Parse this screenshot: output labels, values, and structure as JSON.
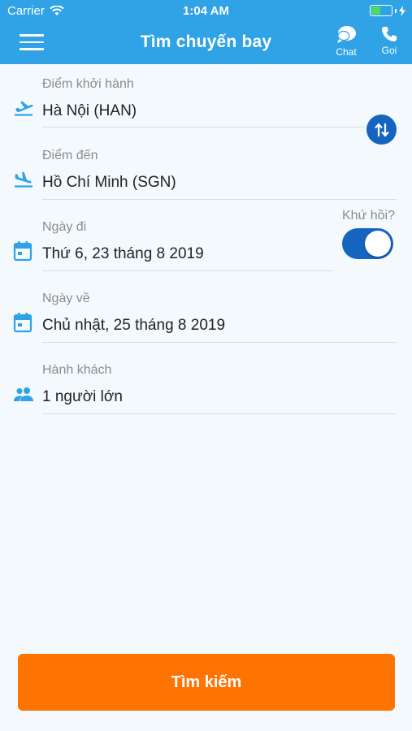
{
  "status_bar": {
    "carrier": "Carrier",
    "time": "1:04 AM"
  },
  "header": {
    "title": "Tìm chuyến bay",
    "chat_label": "Chat",
    "call_label": "Gọi",
    "color": "#2fa3e6"
  },
  "form": {
    "origin": {
      "label": "Điểm khởi hành",
      "value": "Hà Nội (HAN)"
    },
    "destination": {
      "label": "Điểm đến",
      "value": "Hồ Chí Minh (SGN)"
    },
    "depart_date": {
      "label": "Ngày đi",
      "value": "Thứ 6, 23 tháng 8 2019"
    },
    "return_date": {
      "label": "Ngày về",
      "value": "Chủ nhật, 25 tháng 8 2019"
    },
    "passengers": {
      "label": "Hành khách",
      "value": "1 người lớn"
    },
    "round_trip": {
      "label": "Khứ hồi?",
      "enabled": true
    }
  },
  "search_button": {
    "label": "Tìm kiếm",
    "color": "#ff7300"
  },
  "icons": {
    "menu": "menu-icon",
    "chat": "chat-icon",
    "call": "phone-icon",
    "takeoff": "takeoff-icon",
    "landing": "landing-icon",
    "calendar": "calendar-icon",
    "passengers": "people-icon",
    "swap": "swap-icon"
  }
}
